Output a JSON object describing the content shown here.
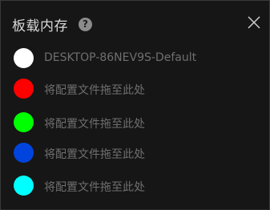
{
  "header": {
    "title": "板载内存",
    "help_icon_label": "?",
    "help_icon": "question-circle-icon",
    "close_icon": "close-icon"
  },
  "items": [
    {
      "label": "DESKTOP-86NEV9S-Default",
      "color": "#ffffff"
    },
    {
      "label": "将配置文件拖至此处",
      "color": "#ff0000"
    },
    {
      "label": "将配置文件拖至此处",
      "color": "#00ff00"
    },
    {
      "label": "将配置文件拖至此处",
      "color": "#0044dd"
    },
    {
      "label": "将配置文件拖至此处",
      "color": "#00ffff"
    }
  ]
}
